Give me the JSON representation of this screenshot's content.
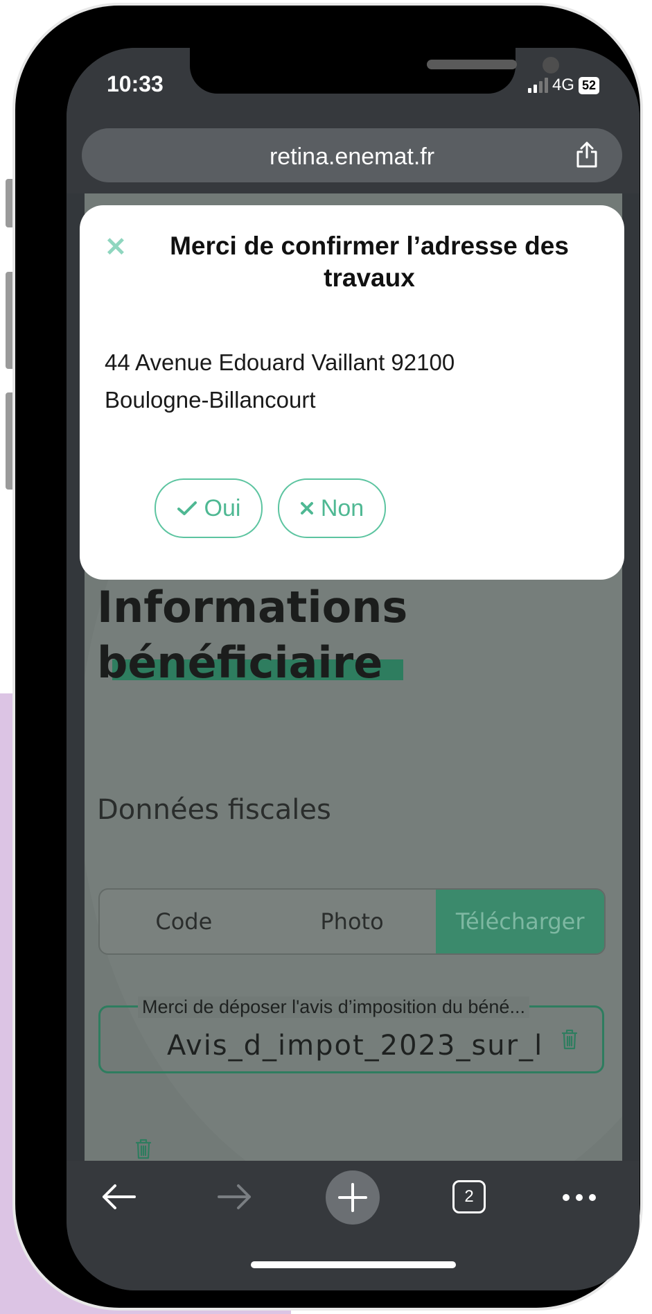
{
  "status_bar": {
    "time": "10:33",
    "network": "4G",
    "battery": "52"
  },
  "browser": {
    "url": "retina.enemat.fr",
    "tab_count": "2"
  },
  "page": {
    "title_line1": "Informations",
    "title_line2": "bénéficiaire",
    "section_title": "Données fiscales",
    "segments": [
      {
        "label": "Code",
        "active": false
      },
      {
        "label": "Photo",
        "active": false
      },
      {
        "label": "Télécharger",
        "active": true
      }
    ],
    "upload": {
      "label": "Merci de déposer l'avis d’imposition du béné...",
      "value": "Avis_d_impot_2023_sur_l"
    }
  },
  "modal": {
    "close_glyph": "✕",
    "title": "Merci de confirmer l’adresse des travaux",
    "address_line1": "44 Avenue Edouard Vaillant 92100",
    "address_line2": "Boulogne-Billancourt",
    "yes_label": "Oui",
    "no_label": "Non"
  },
  "colors": {
    "accent": "#4fb893",
    "brand_green": "#2e7d5f",
    "backdrop_bg": "#dcc4e4"
  }
}
